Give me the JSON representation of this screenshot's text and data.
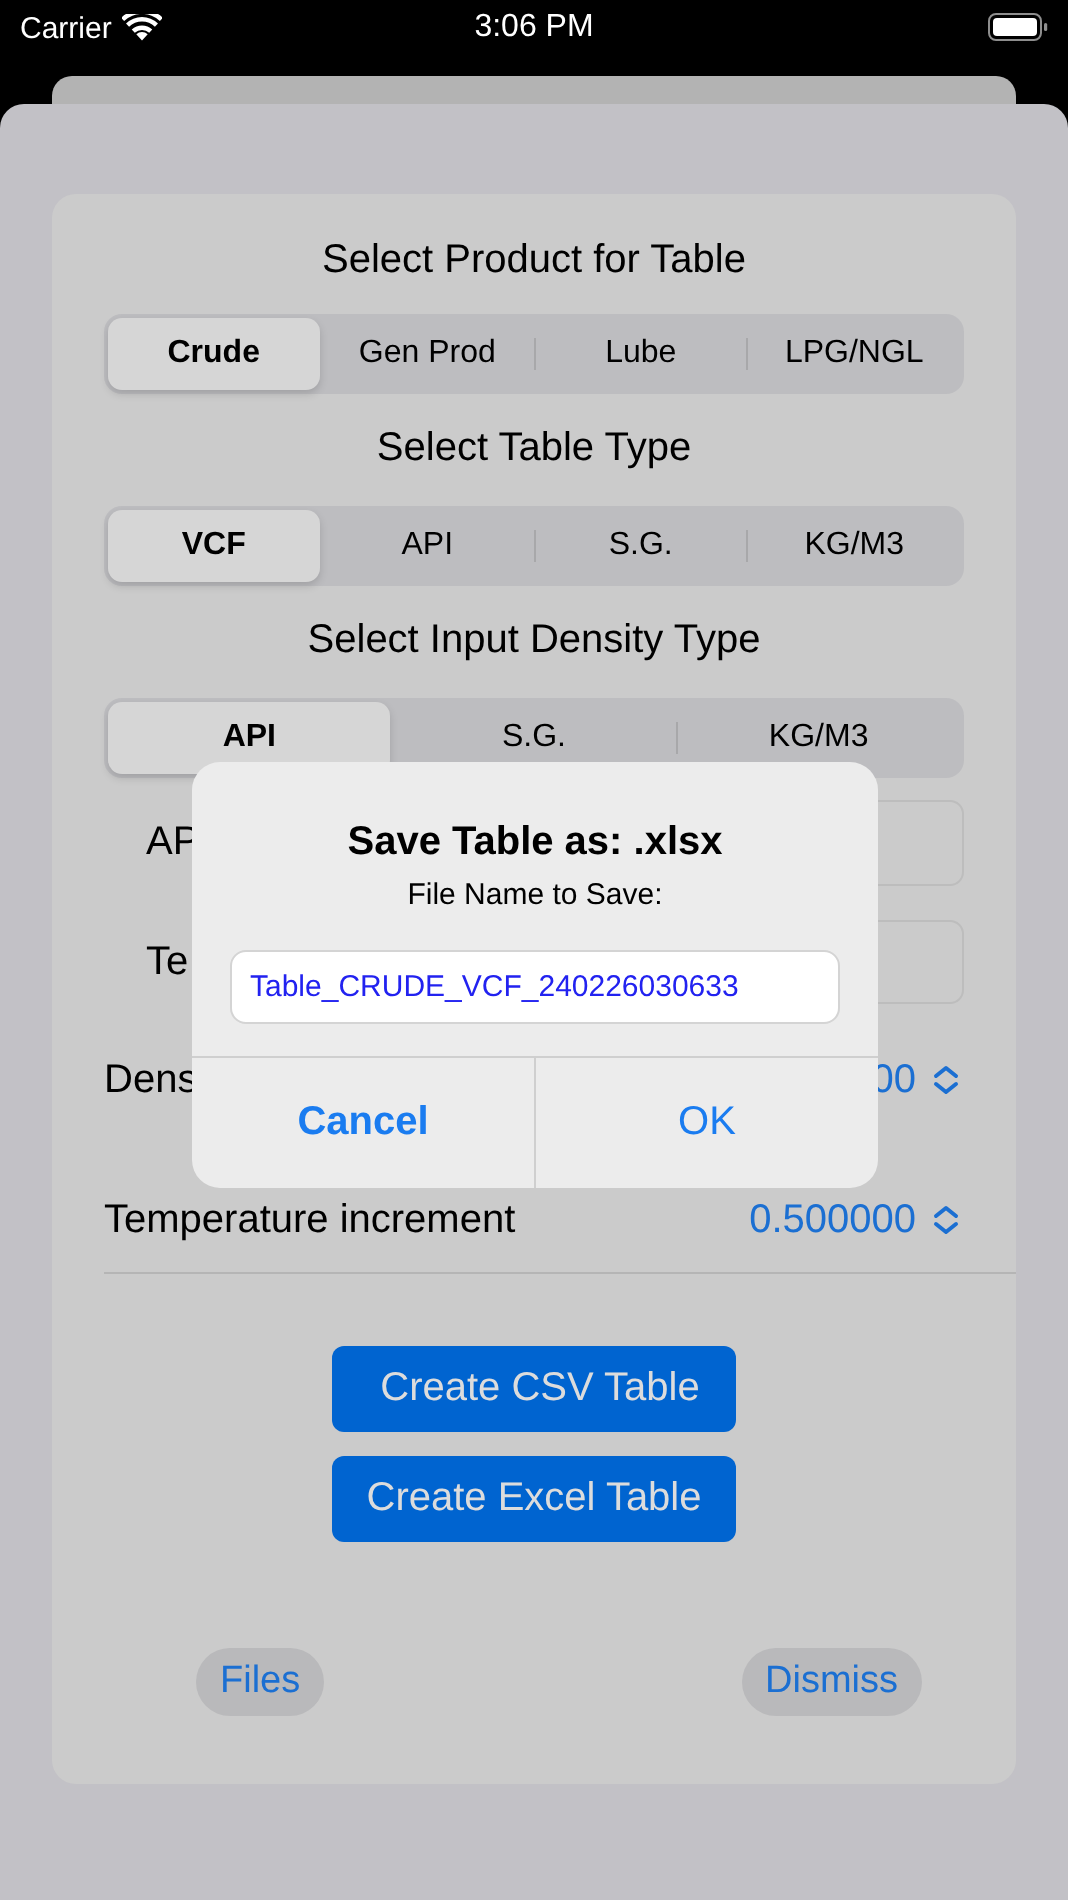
{
  "status_bar": {
    "carrier": "Carrier",
    "time": "3:06 PM"
  },
  "sections": [
    {
      "title": "Select Product for Table",
      "segments": [
        {
          "label": "Crude",
          "selected": true
        },
        {
          "label": "Gen Prod",
          "selected": false
        },
        {
          "label": "Lube",
          "selected": false
        },
        {
          "label": "LPG/NGL",
          "selected": false
        }
      ]
    },
    {
      "title": "Select Table Type",
      "segments": [
        {
          "label": "VCF",
          "selected": true
        },
        {
          "label": "API",
          "selected": false
        },
        {
          "label": "S.G.",
          "selected": false
        },
        {
          "label": "KG/M3",
          "selected": false
        }
      ]
    },
    {
      "title": "Select Input Density Type",
      "segments": [
        {
          "label": "API",
          "selected": true
        },
        {
          "label": "S.G.",
          "selected": false
        },
        {
          "label": "KG/M3",
          "selected": false
        }
      ]
    }
  ],
  "fields": [
    {
      "label": "AP"
    },
    {
      "label": "Te"
    }
  ],
  "steppers": [
    {
      "label": "Dens",
      "value": "00"
    },
    {
      "label": "Temperature increment",
      "value": "0.500000"
    }
  ],
  "buttons": [
    {
      "label": "Create CSV Table"
    },
    {
      "label": "Create Excel Table"
    }
  ],
  "footer": {
    "left": "Files",
    "right": "Dismiss"
  },
  "alert": {
    "title": "Save Table as: .xlsx",
    "message": "File Name to Save:",
    "value": "Table_CRUDE_VCF_240226030633",
    "actions": [
      {
        "label": "Cancel",
        "kind": "cancel"
      },
      {
        "label": "OK",
        "kind": "default"
      }
    ]
  }
}
